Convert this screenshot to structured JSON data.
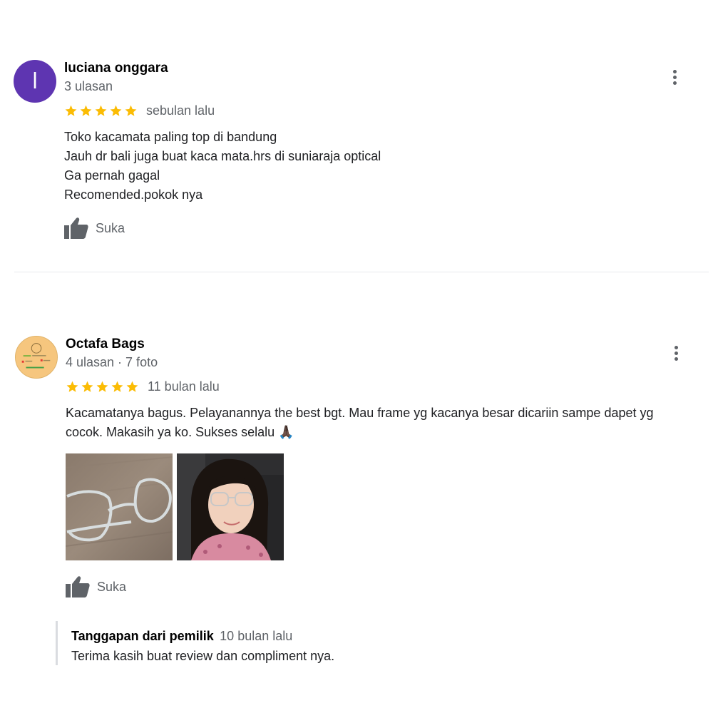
{
  "reviews": [
    {
      "avatar_letter": "l",
      "avatar_color": "#5e35b1",
      "name": "luciana onggara",
      "meta": "3 ulasan",
      "rating": 5,
      "date": "sebulan lalu",
      "lines": [
        "Toko kacamata paling top di bandung",
        "Jauh dr bali juga buat kaca mata.hrs di suniaraja optical",
        "Ga pernah gagal",
        "Recomended.pokok nya"
      ],
      "like_label": "Suka"
    },
    {
      "name": "Octafa Bags",
      "meta": "4 ulasan · 7 foto",
      "rating": 5,
      "date": "11 bulan lalu",
      "lines": [
        "Kacamatanya bagus. Pelayanannya the best bgt. Mau frame yg kacanya besar dicariin sampe dapet yg",
        "cocok. Makasih ya ko. Sukses selalu 🙏🏿"
      ],
      "photos": [
        "eyeglasses-on-table",
        "woman-wearing-glasses-selfie"
      ],
      "like_label": "Suka",
      "owner_reply": {
        "title": "Tanggapan dari pemilik",
        "date": "10 bulan lalu",
        "text": "Terima kasih buat review dan compliment nya."
      }
    }
  ],
  "colors": {
    "star": "#fbbc04",
    "muted": "#5f6368",
    "divider": "#e8eaed"
  }
}
